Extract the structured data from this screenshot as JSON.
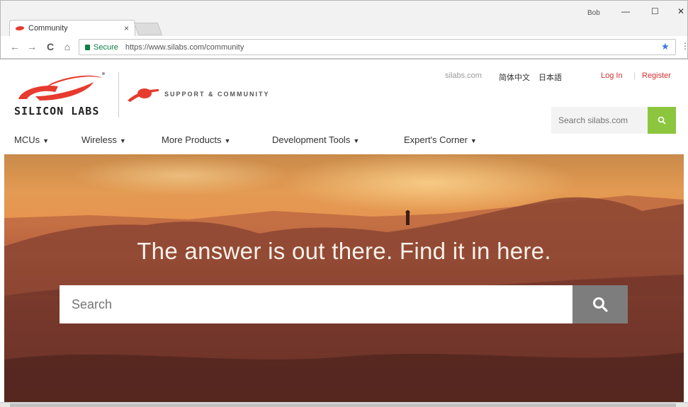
{
  "browser": {
    "tab_title": "Community",
    "tab_close": "×",
    "user_label": "Bob",
    "win_minimize": "—",
    "win_maximize": "☐",
    "win_close": "✕",
    "back": "←",
    "forward": "→",
    "reload": "C",
    "home": "⌂",
    "secure_label": "Secure",
    "url": "https://www.silabs.com/community",
    "bookmark": "★",
    "menu": "⋮"
  },
  "site": {
    "brand_name": "SILICON LABS",
    "support_label": "SUPPORT & COMMUNITY",
    "top_links": {
      "silabs": "silabs.com",
      "lang_zh": "简体中文",
      "lang_ja": "日本語",
      "login": "Log In",
      "separator": "|",
      "register": "Register"
    },
    "search": {
      "placeholder": "Search silabs.com",
      "button_icon": "search-icon"
    },
    "nav": [
      {
        "label": "MCUs"
      },
      {
        "label": "Wireless"
      },
      {
        "label": "More Products"
      },
      {
        "label": "Development Tools"
      },
      {
        "label": "Expert's Corner"
      }
    ],
    "nav_caret": "▼"
  },
  "hero": {
    "heading": "The answer is out there. Find it in here.",
    "search_placeholder": "Search",
    "search_icon": "search-icon"
  },
  "colors": {
    "brand_red": "#e63b2e",
    "search_green": "#8cc63f",
    "link_red": "#d32f2f",
    "hero_button": "#7d7d7d"
  }
}
